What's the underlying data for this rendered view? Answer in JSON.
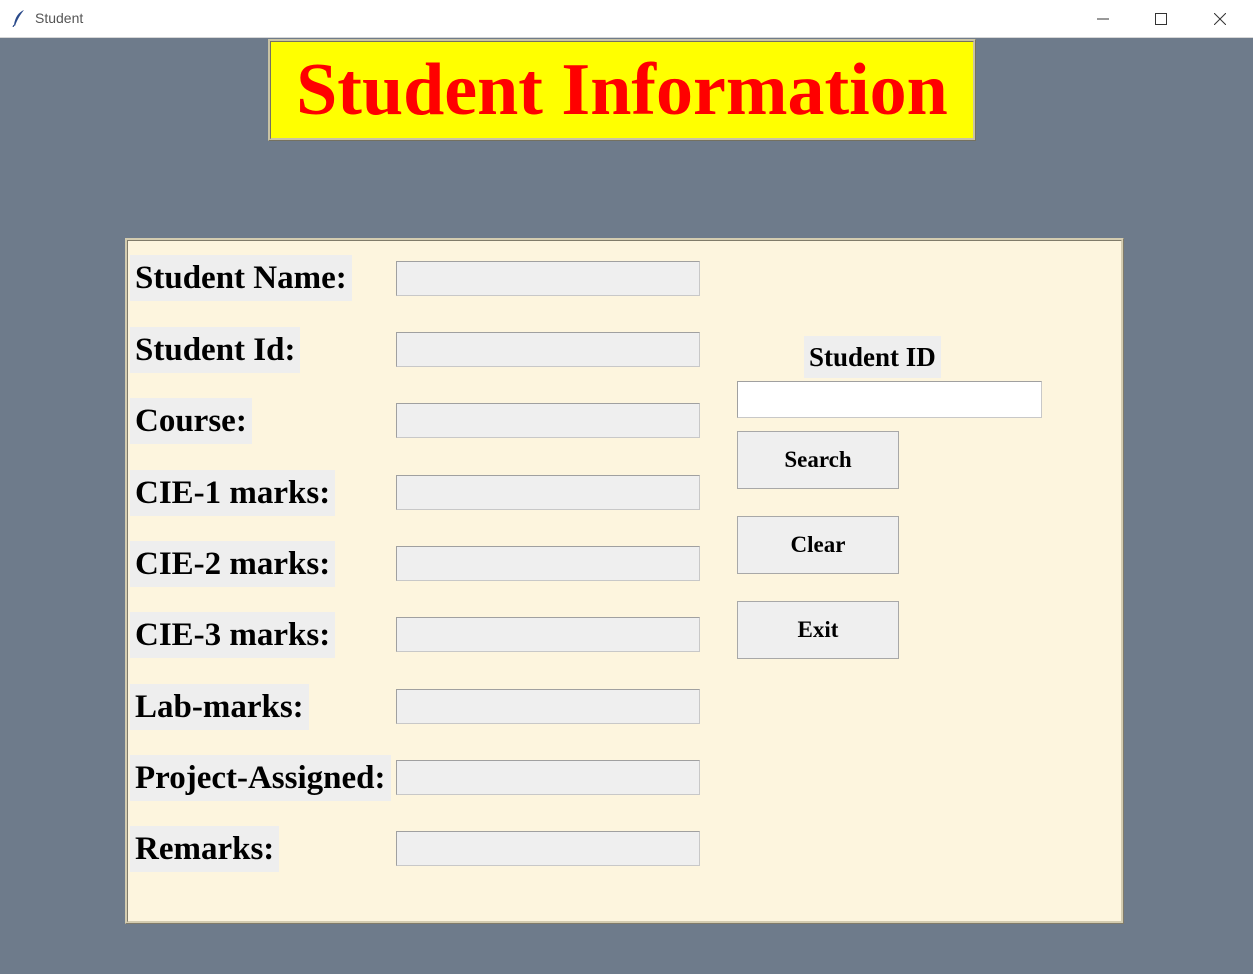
{
  "window": {
    "title": "Student",
    "icon": "feather-icon"
  },
  "heading": "Student Information",
  "form": {
    "fields": [
      {
        "label": "Student Name:",
        "value": ""
      },
      {
        "label": "Student Id:",
        "value": ""
      },
      {
        "label": "Course:",
        "value": ""
      },
      {
        "label": "CIE-1 marks:",
        "value": ""
      },
      {
        "label": "CIE-2 marks:",
        "value": ""
      },
      {
        "label": "CIE-3 marks:",
        "value": ""
      },
      {
        "label": "Lab-marks:",
        "value": ""
      },
      {
        "label": "Project-Assigned:",
        "value": ""
      },
      {
        "label": "Remarks:",
        "value": ""
      }
    ]
  },
  "search": {
    "label": "Student ID",
    "value": "",
    "buttons": {
      "search": "Search",
      "clear": "Clear",
      "exit": "Exit"
    }
  },
  "colors": {
    "background": "#6e7b8b",
    "heading_bg": "#ffff00",
    "heading_text": "#ff0000",
    "panel_bg": "#fdf5de"
  }
}
